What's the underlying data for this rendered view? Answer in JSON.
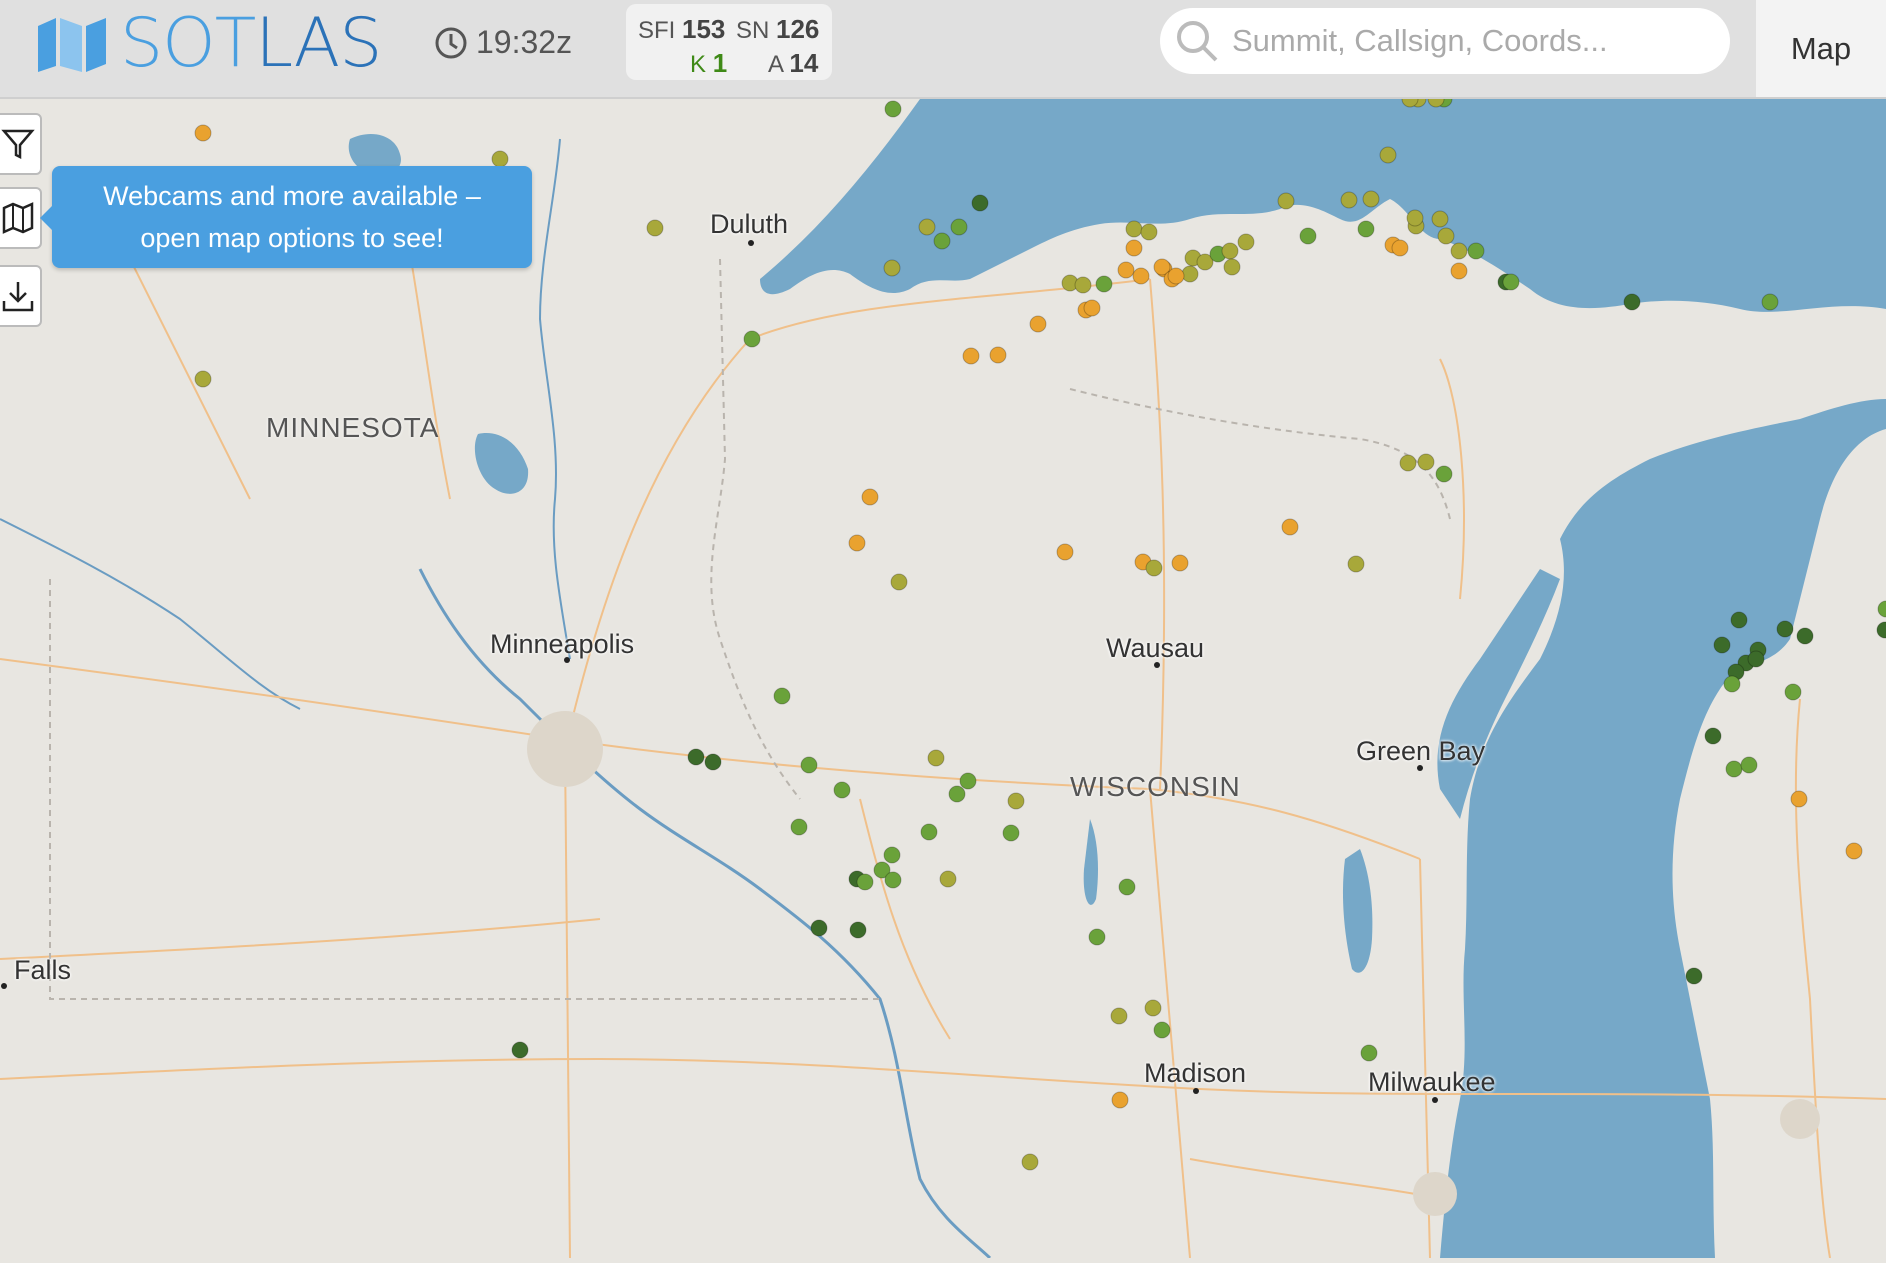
{
  "header": {
    "logo_text_a": "SOT",
    "logo_text_b": "LAS",
    "time": "19:32z",
    "solar": {
      "sfi_label": "SFI",
      "sfi_value": "153",
      "sn_label": "SN",
      "sn_value": "126",
      "k_label": "K",
      "k_value": "1",
      "a_label": "A",
      "a_value": "14"
    },
    "search_placeholder": "Summit, Callsign, Coords...",
    "map_tab": "Map"
  },
  "tooltip": {
    "line1": "Webcams and more available –",
    "line2": "open map options to see!"
  },
  "map": {
    "cities": [
      "Duluth",
      "Minneapolis",
      "Wausau",
      "Green Bay",
      "Madison",
      "Milwaukee",
      "Falls"
    ],
    "states": [
      "MINNESOTA",
      "WISCONSIN"
    ]
  },
  "colors": {
    "water": "#76a8c8",
    "land": "#e8e6e1",
    "summit_orange": "#e9a22f",
    "summit_olive": "#a8a83a",
    "summit_green": "#6aa23a",
    "summit_dark": "#3c6b2a",
    "accent": "#4a9fe0"
  }
}
